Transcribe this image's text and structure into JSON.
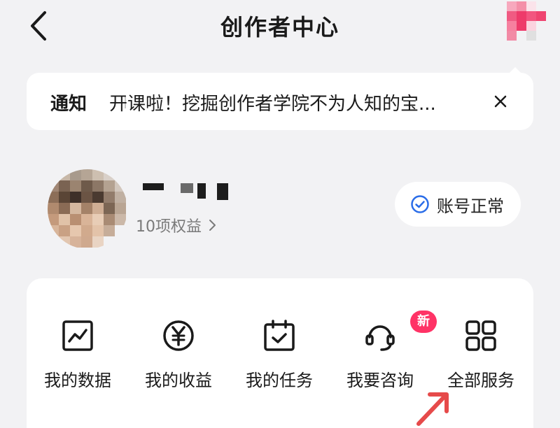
{
  "header": {
    "title": "创作者中心",
    "back_icon": "chevron-left-icon"
  },
  "notice": {
    "label": "通知",
    "text": "开课啦！挖掘创作者学院不为人知的宝...",
    "close_icon": "close-icon"
  },
  "profile": {
    "rights_text": "10项权益",
    "status_text": "账号正常",
    "status_icon": "check-circle-icon"
  },
  "services": [
    {
      "label": "我的数据",
      "icon": "chart-icon"
    },
    {
      "label": "我的收益",
      "icon": "yen-icon"
    },
    {
      "label": "我的任务",
      "icon": "calendar-check-icon"
    },
    {
      "label": "我要咨询",
      "icon": "headset-icon",
      "badge": "新"
    },
    {
      "label": "全部服务",
      "icon": "grid-icon"
    }
  ],
  "colors": {
    "background": "#f2f2f4",
    "accent_blue": "#2b6de8",
    "badge_pink": "#ff3366",
    "annotation_arrow": "#e64a4a"
  }
}
